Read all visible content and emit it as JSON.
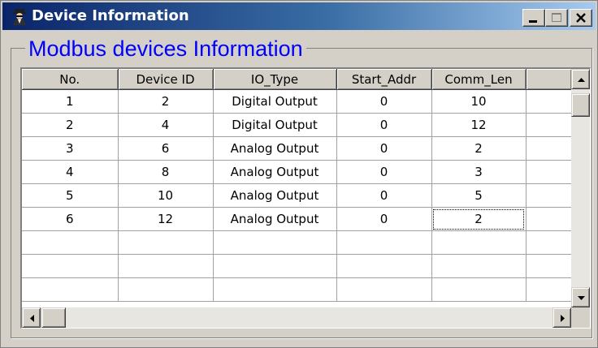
{
  "window": {
    "title": "Device Information",
    "minimize_icon": "minimize-icon",
    "maximize_icon": "maximize-icon",
    "close_icon": "close-icon",
    "app_icon": "spy-agent-icon"
  },
  "group": {
    "title": "Modbus devices Information"
  },
  "table": {
    "columns": [
      "No.",
      "Device ID",
      "IO_Type",
      "Start_Addr",
      "Comm_Len"
    ],
    "rows": [
      [
        "1",
        "2",
        "Digital Output",
        "0",
        "10"
      ],
      [
        "2",
        "4",
        "Digital Output",
        "0",
        "12"
      ],
      [
        "3",
        "6",
        "Analog  Output",
        "0",
        "2"
      ],
      [
        "4",
        "8",
        "Analog  Output",
        "0",
        "3"
      ],
      [
        "5",
        "10",
        "Analog  Output",
        "0",
        "5"
      ],
      [
        "6",
        "12",
        "Analog  Output",
        "0",
        "2"
      ]
    ],
    "focused_cell": {
      "row": 6,
      "column": "Comm_Len"
    }
  },
  "colors": {
    "title_bar_start": "#0a246a",
    "title_bar_end": "#a6caf0",
    "group_title": "#0000ff",
    "face": "#d4d0c8"
  }
}
